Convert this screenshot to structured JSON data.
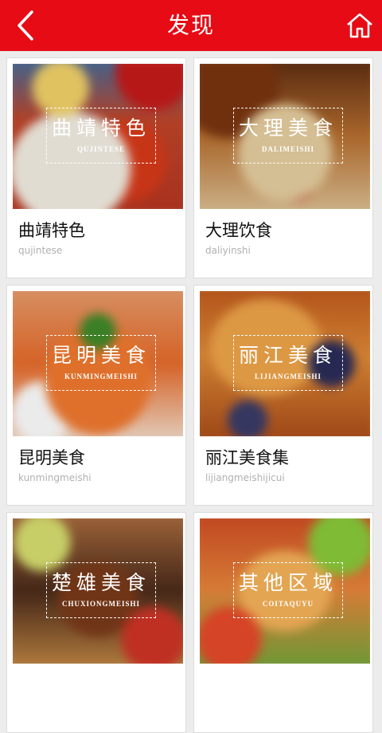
{
  "header": {
    "title": "发现",
    "back_icon": "back-chevron-icon",
    "home_icon": "home-icon",
    "background_color": "#e60b15"
  },
  "cards": [
    {
      "badge_cn": "曲靖特色",
      "badge_py": "QUJINTESE",
      "name": "曲靖特色",
      "sub": "qujintese"
    },
    {
      "badge_cn": "大理美食",
      "badge_py": "DALIMEISHI",
      "name": "大理饮食",
      "sub": "daliyinshi"
    },
    {
      "badge_cn": "昆明美食",
      "badge_py": "KUNMINGMEISHI",
      "name": "昆明美食",
      "sub": "kunmingmeishi"
    },
    {
      "badge_cn": "丽江美食",
      "badge_py": "LIJIANGMEISHI",
      "name": "丽江美食集",
      "sub": "lijiangmeishijicui"
    },
    {
      "badge_cn": "楚雄美食",
      "badge_py": "CHUXIONGMEISHI",
      "name": "",
      "sub": ""
    },
    {
      "badge_cn": "其他区域",
      "badge_py": "COITAQUYU",
      "name": "",
      "sub": ""
    }
  ]
}
